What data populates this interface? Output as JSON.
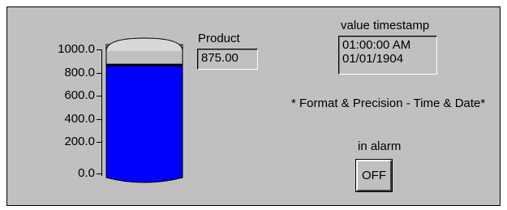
{
  "tank": {
    "scale_labels": [
      "1000.0",
      "800.0",
      "600.0",
      "400.0",
      "200.0",
      "0.0"
    ],
    "level": 875,
    "max": 1000,
    "fill_color": "#0000ff"
  },
  "product": {
    "label": "Product",
    "value": "875.00"
  },
  "timestamp": {
    "label": "value timestamp",
    "time": "01:00:00 AM",
    "date": "01/01/1904"
  },
  "note": "* Format & Precision - Time & Date*",
  "alarm": {
    "label": "in alarm",
    "button_text": "OFF"
  }
}
